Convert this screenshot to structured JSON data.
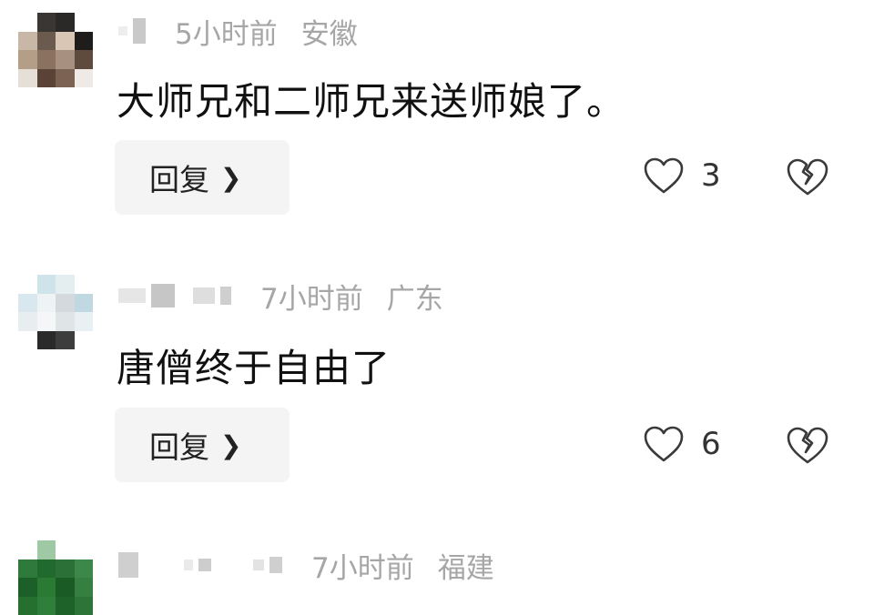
{
  "comments": [
    {
      "time": "5小时前",
      "location": "安徽",
      "text": "大师兄和二师兄来送师娘了。",
      "reply_label": "回复",
      "likes": "3"
    },
    {
      "time": "7小时前",
      "location": "广东",
      "text": "唐僧终于自由了",
      "reply_label": "回复",
      "likes": "6"
    },
    {
      "time": "7小时前",
      "location": "福建"
    }
  ],
  "icons": {
    "reply_chevron": "chevron-right-icon",
    "like": "heart-icon",
    "dislike": "broken-heart-icon"
  },
  "colors": {
    "background": "#ffffff",
    "meta_text": "#a6a6a6",
    "reply_button_bg": "#f4f4f4"
  }
}
